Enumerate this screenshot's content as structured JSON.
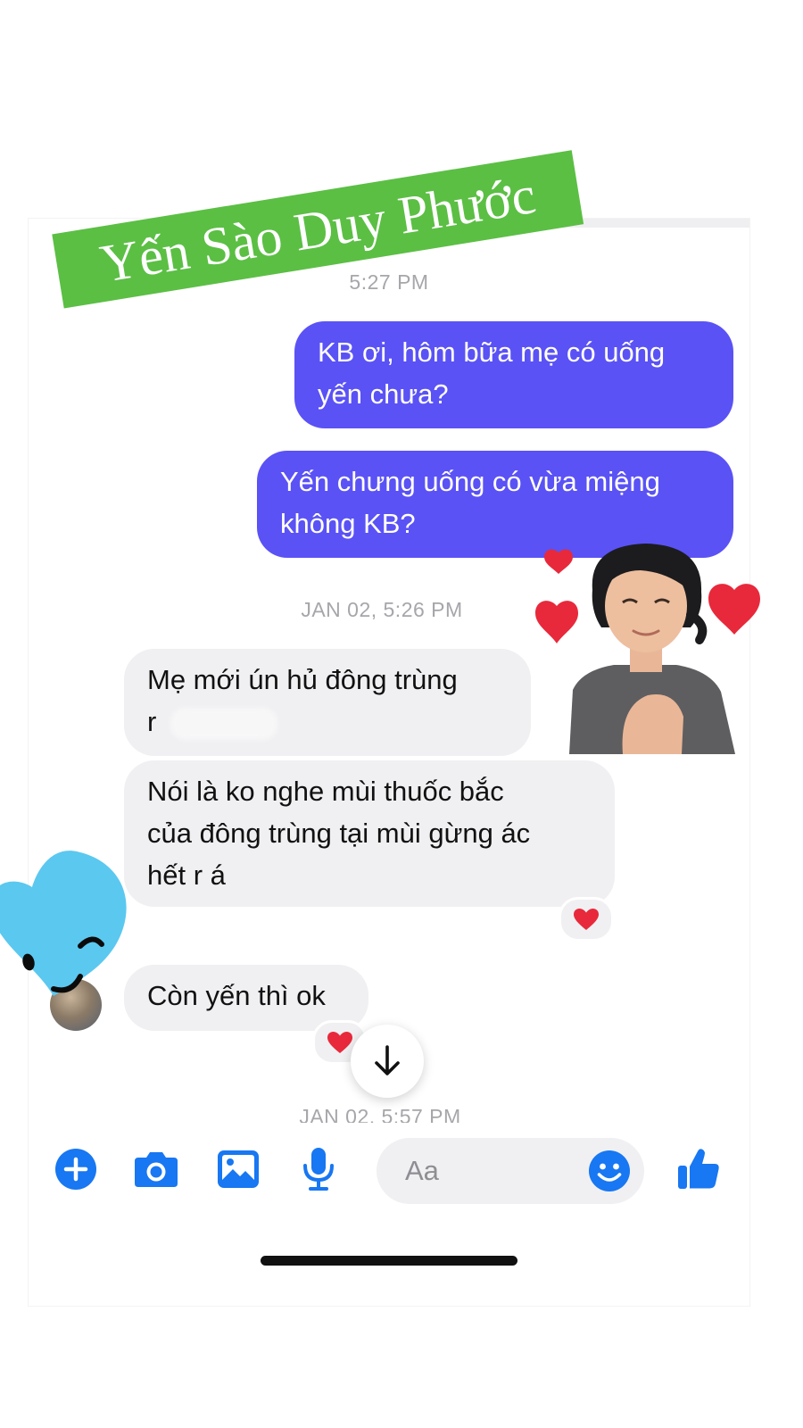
{
  "watermark": {
    "text": "Yến Sào Duy Phước"
  },
  "conversation": {
    "timestamp_top": "5:27 PM",
    "messages_out": [
      {
        "text_line1": "KB ơi, hôm bữa mẹ có uống",
        "text_line2": "yến chưa?"
      },
      {
        "text_line1": "Yến chưng uống có vừa miệng",
        "text_line2": "không KB?"
      }
    ],
    "timestamp_mid": "JAN 02, 5:26 PM",
    "messages_in": [
      {
        "text_line1": "Mẹ mới ún hủ đông trùng",
        "text_line2": "r"
      },
      {
        "text_line1": "Nói là ko nghe mùi thuốc bắc",
        "text_line2": "của đông trùng tại mùi gừng ác",
        "text_line3": "hết r á",
        "reaction": "heart"
      },
      {
        "text_line1": "Còn yến thì ok",
        "reaction": "heart"
      }
    ],
    "timestamp_bottom": "JAN 02, 5:57 PM"
  },
  "composer": {
    "placeholder": "Aa",
    "tools": [
      "plus-icon",
      "camera-icon",
      "image-icon",
      "microphone-icon"
    ],
    "emoji": "smile-icon",
    "send": "thumbs-up-icon"
  },
  "colors": {
    "accent": "#1877f2",
    "outgoing_bubble": "#5a52f5",
    "incoming_bubble": "#f0f0f2",
    "watermark_bg": "#5bbf44",
    "heart": "#e8293b",
    "sticker_heart": "#5bc8f0"
  }
}
